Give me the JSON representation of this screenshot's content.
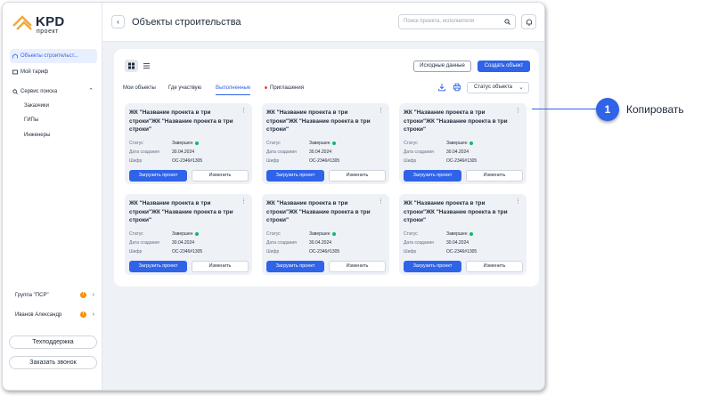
{
  "sidebar": {
    "logo_text": "KPD",
    "logo_sub": "проект",
    "nav": [
      {
        "label": "Объекты строительст...",
        "icon": "building-icon"
      },
      {
        "label": "Мой тариф",
        "icon": "tariff-icon"
      },
      {
        "label": "Сервис поиска",
        "icon": "search-service-icon"
      }
    ],
    "sub_items": [
      "Заказчики",
      "ГИПы",
      "Инженеры"
    ],
    "accounts": [
      {
        "label": "Группа \"ПСР\"",
        "badge": "!"
      },
      {
        "label": "Иванов Александр",
        "badge": "!"
      }
    ],
    "support_btn": "Техподдержка",
    "call_btn": "Заказать звонок"
  },
  "topbar": {
    "title": "Объекты строительства",
    "search_placeholder": "Поиск проекта, исполнителя"
  },
  "toolbar": {
    "source_btn": "Исходные данные",
    "create_btn": "Создать объект"
  },
  "tabs": [
    "Мои объекты",
    "Где участвую",
    "Выполненные",
    "Приглашения"
  ],
  "status_filter": "Статус объекта",
  "cards": [
    {
      "title": "ЖК \"Название проекта в три строки\"ЖК \"Название проекта в три строки\"",
      "status_label": "Статус",
      "status": "Завершен",
      "date_label": "Дата создания",
      "date": "30.04.2024",
      "code_label": "Шифр",
      "code": "ОС-2346#1305",
      "upload_btn": "Загрузить проект",
      "edit_btn": "Изменить"
    },
    {
      "title": "ЖК \"Название проекта в три строки\"ЖК \"Название проекта в три строки\"",
      "status_label": "Статус",
      "status": "Завершен",
      "date_label": "Дата создания",
      "date": "30.04.2024",
      "code_label": "Шифр",
      "code": "ОС-2346#1305",
      "upload_btn": "Загрузить проект",
      "edit_btn": "Изменить"
    },
    {
      "title": "ЖК \"Название проекта в три строки\"ЖК \"Название проекта в три строки\"",
      "status_label": "Статус",
      "status": "Завершен",
      "date_label": "Дата создания",
      "date": "30.04.2024",
      "code_label": "Шифр",
      "code": "ОС-2346#1305",
      "upload_btn": "Загрузить проект",
      "edit_btn": "Изменить"
    },
    {
      "title": "ЖК \"Название проекта в три строки\"ЖК \"Название проекта в три строки\"",
      "status_label": "Статус",
      "status": "Завершен",
      "date_label": "Дата создания",
      "date": "30.04.2024",
      "code_label": "Шифр",
      "code": "ОС-2346#1305",
      "upload_btn": "Загрузить проект",
      "edit_btn": "Изменить"
    },
    {
      "title": "ЖК \"Название проекта в три строки\"ЖК \"Название проекта в три строки\"",
      "status_label": "Статус",
      "status": "Завершен",
      "date_label": "Дата создания",
      "date": "30.04.2024",
      "code_label": "Шифр",
      "code": "ОС-2346#1305",
      "upload_btn": "Загрузить проект",
      "edit_btn": "Изменить"
    },
    {
      "title": "ЖК \"Название проекта в три строки\"ЖК \"Название проекта в три строки\"",
      "status_label": "Статус",
      "status": "Завершен",
      "date_label": "Дата создания",
      "date": "30.04.2024",
      "code_label": "Шифр",
      "code": "ОС-2346#1305",
      "upload_btn": "Загрузить проект",
      "edit_btn": "Изменить"
    }
  ],
  "callout": {
    "number": "1",
    "label": "Копировать"
  },
  "colors": {
    "accent": "#2f63e8",
    "logo": "#f2a83b",
    "status_ok": "#12b76a",
    "warning": "#f79009"
  }
}
